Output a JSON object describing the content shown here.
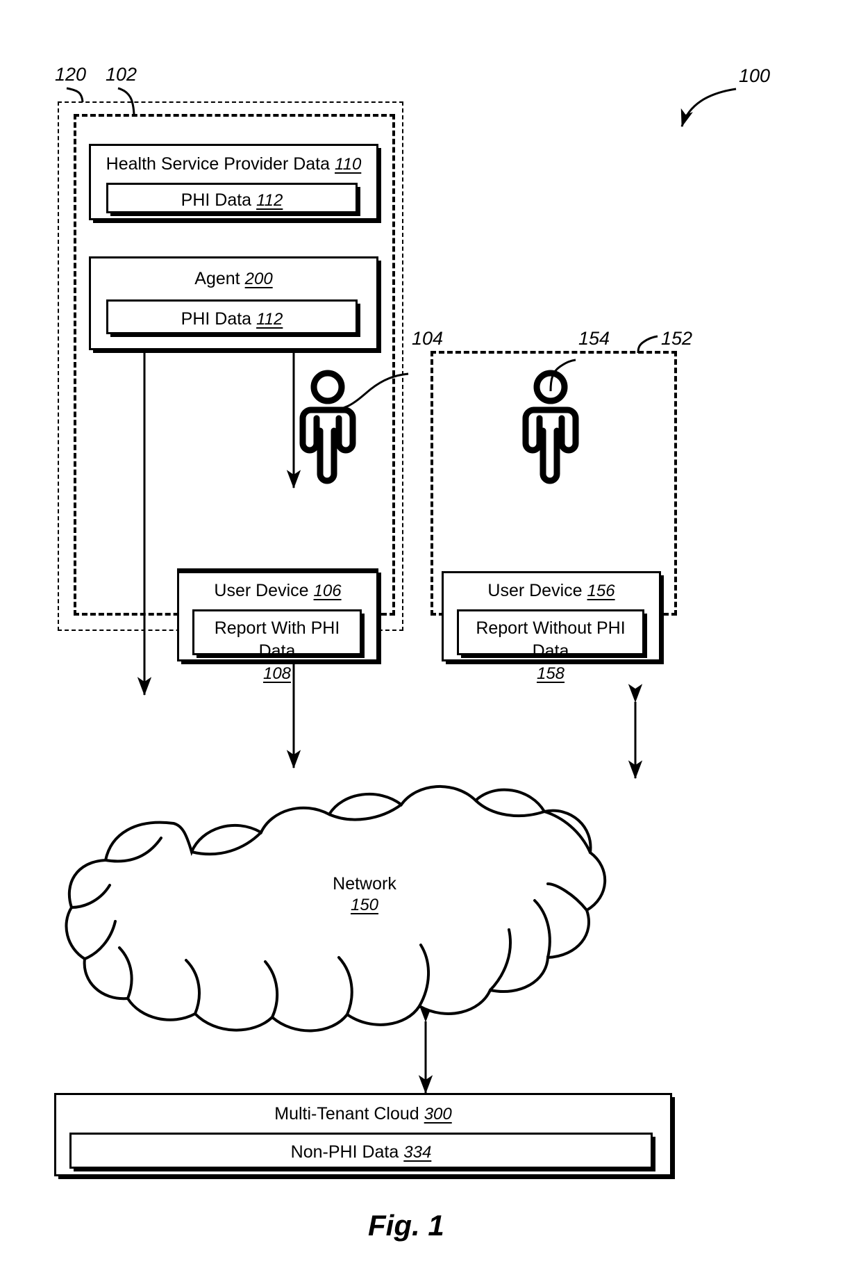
{
  "figure": {
    "caption": "Fig. 1",
    "system_ref": "100"
  },
  "refs": {
    "outer_dashed": "120",
    "inner_dashed": "102",
    "provider_user": "104",
    "remote_user": "154",
    "remote_zone": "152"
  },
  "provider_zone": {
    "health_service_provider_data": {
      "title": "Health Service Provider Data",
      "ref": "110",
      "inner": {
        "title": "PHI Data",
        "ref": "112"
      }
    },
    "agent": {
      "title": "Agent",
      "ref": "200",
      "inner": {
        "title": "PHI Data",
        "ref": "112"
      }
    },
    "user_device": {
      "title": "User Device",
      "ref": "106",
      "inner": {
        "title": "Report With PHI Data",
        "ref": "108"
      }
    }
  },
  "remote_zone": {
    "user_device": {
      "title": "User Device",
      "ref": "156",
      "inner": {
        "title": "Report Without PHI Data",
        "ref": "158"
      }
    }
  },
  "network": {
    "title": "Network",
    "ref": "150"
  },
  "cloud_box": {
    "title": "Multi-Tenant Cloud",
    "ref": "300",
    "inner": {
      "title": "Non-PHI Data",
      "ref": "334"
    }
  },
  "colors": {
    "ink": "#000000",
    "paper": "#ffffff"
  }
}
